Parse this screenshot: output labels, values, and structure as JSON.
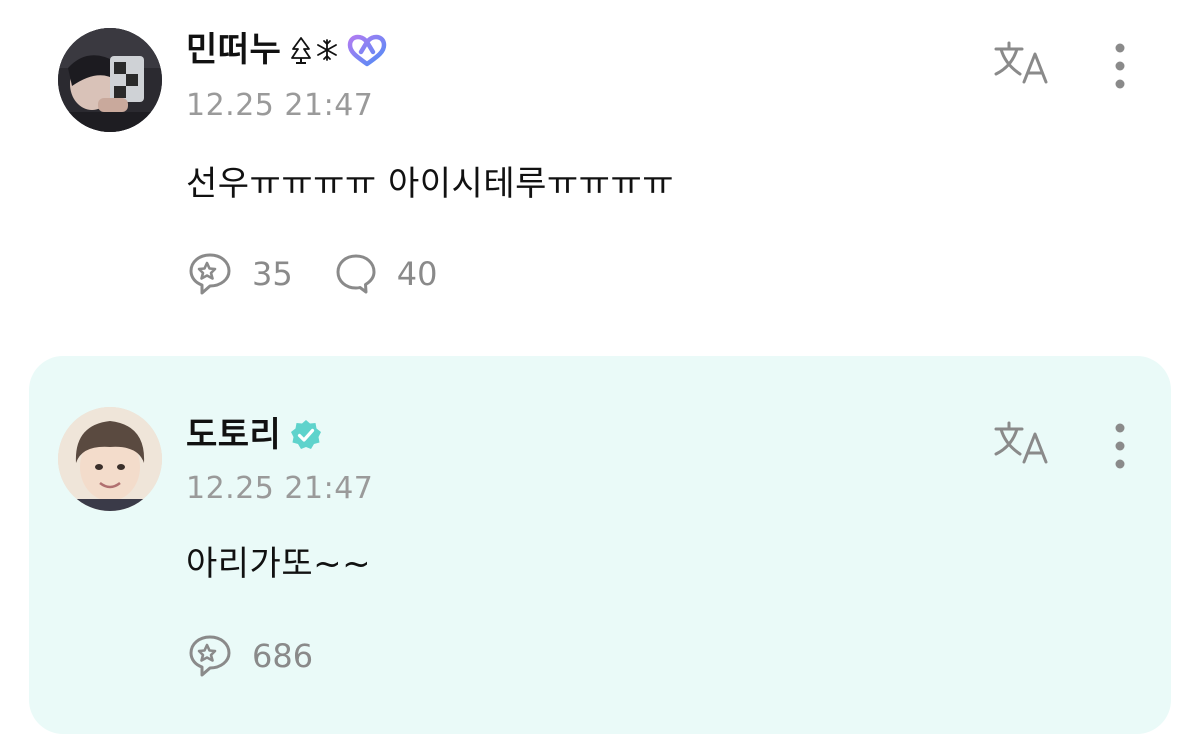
{
  "posts": [
    {
      "author": "민떠누",
      "timestamp": "12.25 21:47",
      "content": "선우ㅠㅠㅠㅠ 아이시테루ㅠㅠㅠㅠ",
      "reaction_count": "35",
      "comment_count": "40",
      "badge_icons": [
        "tree-emoji-icon",
        "snowflake-emoji-icon",
        "infinity-heart-icon"
      ]
    },
    {
      "author": "도토리",
      "timestamp": "12.25 21:47",
      "content": "아리가또~~",
      "reaction_count": "686",
      "badge_icons": [
        "verified-badge-icon"
      ]
    }
  ],
  "colors": {
    "highlight_bg": "#eafaf8",
    "verified": "#5fd3cc",
    "muted_text": "#9a9a9a",
    "icon_gray": "#8a8a8a"
  }
}
